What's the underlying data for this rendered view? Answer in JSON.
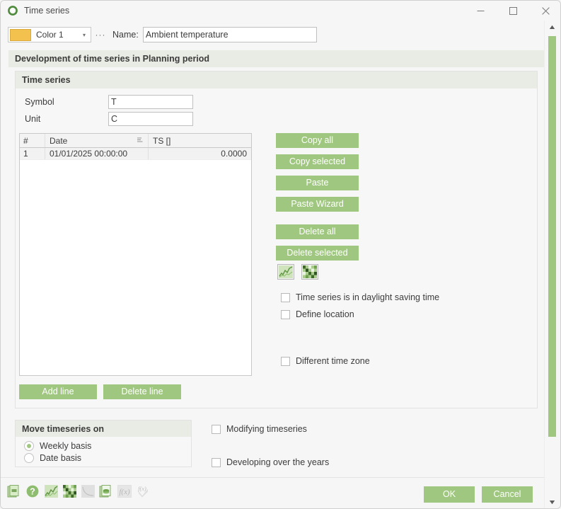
{
  "window": {
    "title": "Time series",
    "icon": "ring-icon",
    "minimize": "minimize-icon",
    "maximize": "maximize-icon",
    "close": "close-icon"
  },
  "toolbar_top": {
    "color_value": "Color 1",
    "color_hex": "#f2c14e",
    "color_caret": "▾",
    "color_ellipsis": "···",
    "name_label": "Name:",
    "name_value": "Ambient temperature",
    "name_placeholder": ""
  },
  "section": {
    "header": "Development of time series in Planning period"
  },
  "ts_group": {
    "header": "Time series",
    "symbol_label": "Symbol",
    "symbol_value": "T",
    "unit_label": "Unit",
    "unit_value": "C"
  },
  "grid": {
    "columns": [
      "#",
      "Date",
      "TS []"
    ],
    "sort_icon": "sort-ascending-icon",
    "rows": [
      {
        "index": "1",
        "date": "01/01/2025 00:00:00",
        "value": "0.0000"
      }
    ]
  },
  "side_buttons": [
    {
      "label": "Copy all",
      "name": "copy-all-button"
    },
    {
      "label": "Copy selected",
      "name": "copy-selected-button"
    },
    {
      "label": "Paste",
      "name": "paste-button"
    },
    {
      "label": "Paste Wizard",
      "name": "paste-wizard-button"
    },
    {
      "label": "Delete all",
      "name": "delete-all-button"
    },
    {
      "label": "Delete selected",
      "name": "delete-selected-button"
    }
  ],
  "icon_buttons": [
    {
      "name": "line-chart-icon-button",
      "icon": "line-chart-icon"
    },
    {
      "name": "heatmap-icon-button",
      "icon": "heatmap-grid-icon"
    }
  ],
  "checkboxes": {
    "daylight": {
      "label": "Time series is in daylight saving time",
      "checked": false
    },
    "location": {
      "label": "Define location",
      "checked": false
    },
    "timezone": {
      "label": "Different time zone",
      "checked": false
    },
    "modifying": {
      "label": "Modifying timeseries",
      "checked": false
    },
    "developing": {
      "label": "Developing over the years",
      "checked": false
    }
  },
  "line_buttons": [
    {
      "label": "Add line",
      "name": "add-line-button"
    },
    {
      "label": "Delete line",
      "name": "delete-line-button"
    }
  ],
  "move_group": {
    "header": "Move timeseries on",
    "options": [
      {
        "label": "Weekly basis",
        "checked": true
      },
      {
        "label": "Date basis",
        "checked": false
      }
    ]
  },
  "bottom_icons": [
    {
      "name": "copy-document-icon",
      "enabled": true
    },
    {
      "name": "help-question-icon",
      "enabled": true
    },
    {
      "name": "line-chart-icon",
      "enabled": true
    },
    {
      "name": "heatmap-grid-icon",
      "enabled": true
    },
    {
      "name": "curve-decay-icon",
      "enabled": false
    },
    {
      "name": "database-document-icon",
      "enabled": true
    },
    {
      "name": "function-fx-icon",
      "enabled": false
    },
    {
      "name": "function-fx-check-icon",
      "enabled": false
    }
  ],
  "dialog_actions": {
    "ok": "OK",
    "cancel": "Cancel"
  },
  "scrollbar": {
    "up": "scroll-up-arrow-icon",
    "down": "scroll-down-arrow-icon",
    "thumb": "scroll-thumb"
  },
  "theme": {
    "accent_green": "#9fc77f",
    "group_header_bg": "#e8ece4",
    "window_bg": "#f6f6f6"
  }
}
